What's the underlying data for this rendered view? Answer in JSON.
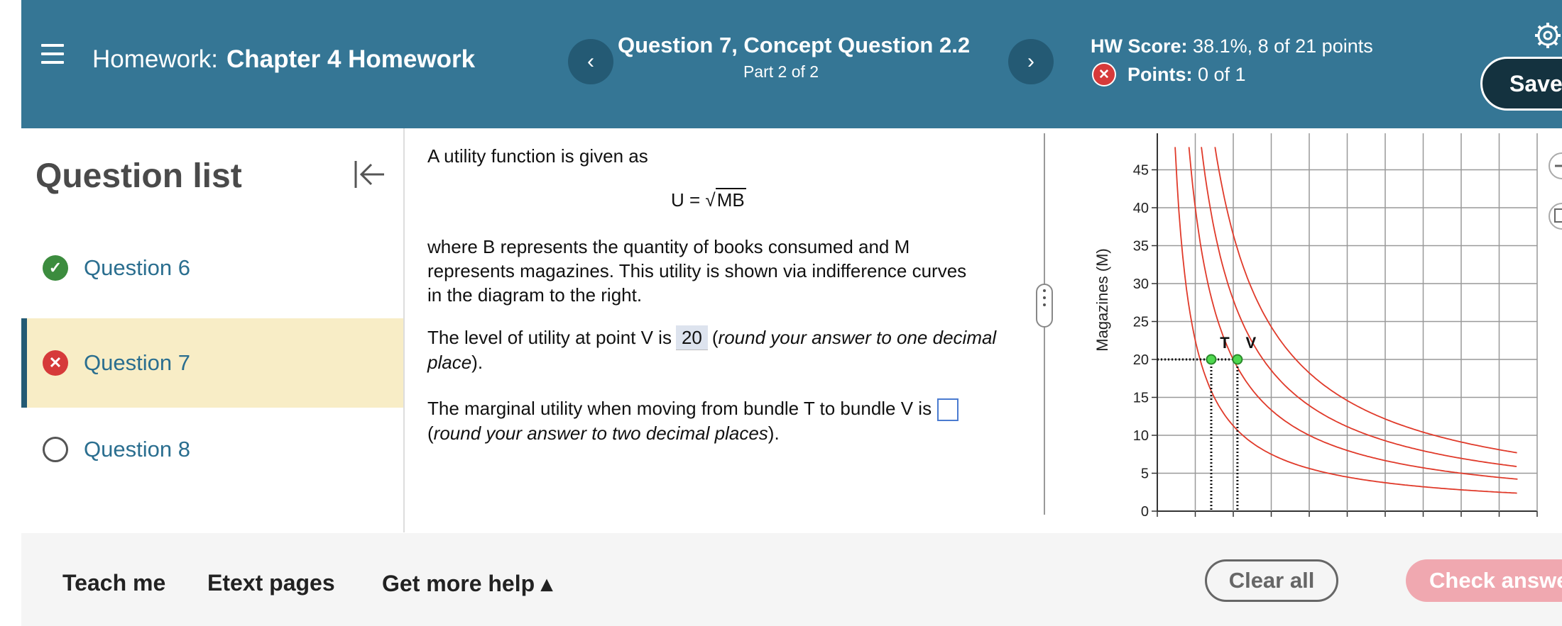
{
  "header": {
    "homework_prefix": "Homework:",
    "homework_title": "Chapter 4 Homework",
    "prev_label": "‹",
    "next_label": "›",
    "question_title": "Question 7, Concept Question 2.2",
    "question_part": "Part 2 of 2",
    "hw_score_label": "HW Score:",
    "hw_score_value": "38.1%, 8 of 21 points",
    "points_label": "Points:",
    "points_value": "0 of 1",
    "save_label": "Save"
  },
  "sidebar": {
    "title": "Question list",
    "items": [
      {
        "label": "Question 6",
        "status": "correct"
      },
      {
        "label": "Question 7",
        "status": "incorrect"
      },
      {
        "label": "Question 8",
        "status": "unanswered"
      }
    ]
  },
  "question": {
    "intro": "A utility function is given as",
    "formula_lhs": "U =",
    "formula_sqrt_sign": "√",
    "formula_radicand": "MB",
    "description": "where B represents the quantity of books consumed and M represents magazines. This utility is shown via indifference curves in the diagram to the right.",
    "part1_prefix": "The level of utility at point V is",
    "part1_answer": "20",
    "part1_instruction": "round your answer to one decimal place",
    "part2_prefix": "The marginal utility when moving from bundle T to bundle V is",
    "part2_instruction": "round your answer to two decimal places"
  },
  "graph": {
    "ylabel": "Magazines (M)",
    "yticks": [
      "0",
      "5",
      "10",
      "15",
      "20",
      "25",
      "30",
      "35",
      "40",
      "45"
    ],
    "point_labels": [
      "T",
      "V"
    ],
    "curve_color": "#e03a2a",
    "point_color": "#4fd84f"
  },
  "footer": {
    "teach_me": "Teach me",
    "etext": "Etext pages",
    "more_help": "Get more help ▴",
    "clear_all": "Clear all",
    "check_answer": "Check answe"
  }
}
